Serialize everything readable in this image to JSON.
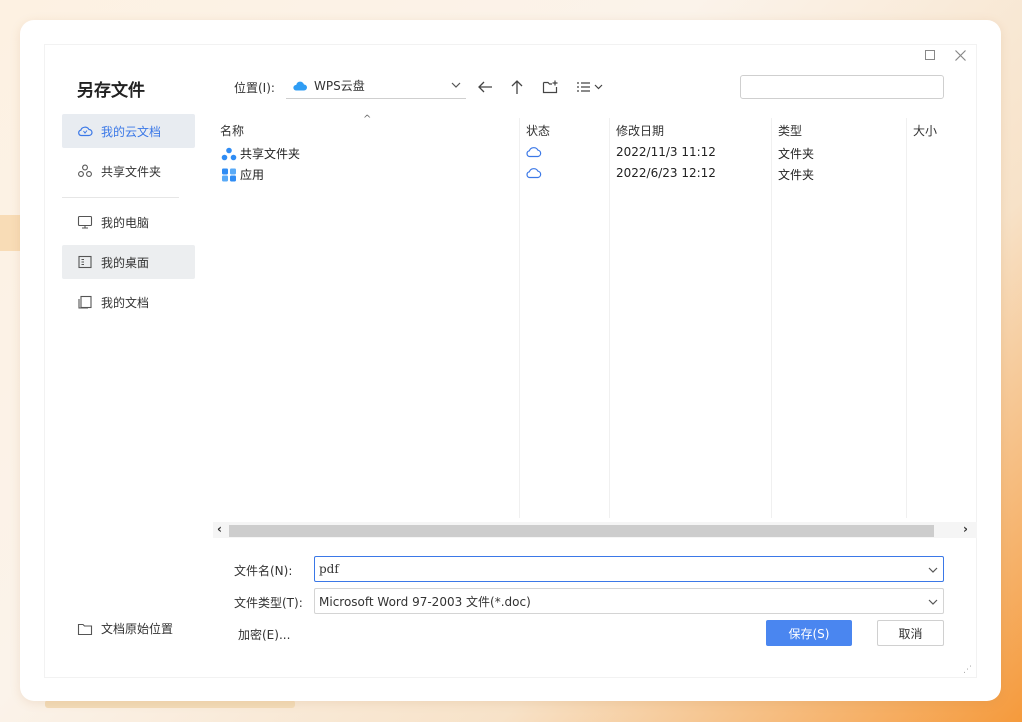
{
  "dialog": {
    "title": "另存文件"
  },
  "sidebar": {
    "items": [
      {
        "label": "我的云文档",
        "icon": "cloud-icon"
      },
      {
        "label": "共享文件夹",
        "icon": "share-icon"
      },
      {
        "label": "我的电脑",
        "icon": "monitor-icon"
      },
      {
        "label": "我的桌面",
        "icon": "desktop-icon"
      },
      {
        "label": "我的文档",
        "icon": "documents-icon"
      }
    ],
    "bottom_label": "文档原始位置"
  },
  "toolbar": {
    "location_label": "位置(I):",
    "location_value": "WPS云盘",
    "search_placeholder": ""
  },
  "list": {
    "columns": [
      "名称",
      "状态",
      "修改日期",
      "类型",
      "大小"
    ],
    "rows": [
      {
        "name": "共享文件夹",
        "status_icon": "cloud-status-icon",
        "date": "2022/11/3 11:12",
        "type": "文件夹",
        "size": ""
      },
      {
        "name": "应用",
        "status_icon": "cloud-status-icon",
        "date": "2022/6/23 12:12",
        "type": "文件夹",
        "size": ""
      }
    ]
  },
  "form": {
    "filename_label": "文件名(N):",
    "filename_value": "pdf",
    "filetype_label": "文件类型(T):",
    "filetype_value": "Microsoft Word 97-2003 文件(*.doc)",
    "encrypt_label": "加密(E)...",
    "save_label": "保存(S)",
    "cancel_label": "取消"
  },
  "colors": {
    "accent": "#3b78e7",
    "save_button": "#4a86f0"
  }
}
